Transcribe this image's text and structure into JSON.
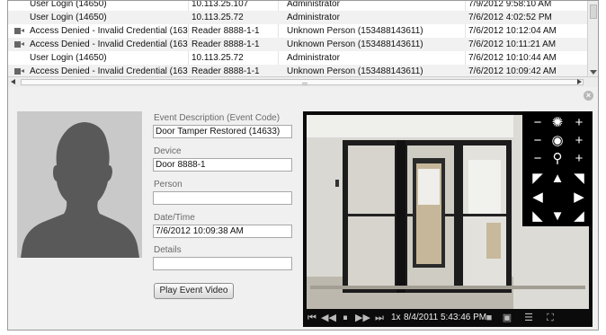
{
  "events": [
    {
      "icon": false,
      "description": "User Login (14650)",
      "device": "10.113.25.107",
      "person": "Administrator",
      "datetime": "7/9/2012 9:58:10 AM"
    },
    {
      "icon": false,
      "description": "User Login (14650)",
      "device": "10.113.25.72",
      "person": "Administrator",
      "datetime": "7/6/2012 4:02:52 PM"
    },
    {
      "icon": true,
      "description": "Access Denied - Invalid Credential (163...",
      "device": "Reader 8888-1-1",
      "person": "Unknown Person (153488143611)",
      "datetime": "7/6/2012 10:12:04 AM"
    },
    {
      "icon": true,
      "description": "Access Denied - Invalid Credential (163...",
      "device": "Reader 8888-1-1",
      "person": "Unknown Person (153488143611)",
      "datetime": "7/6/2012 10:11:21 AM"
    },
    {
      "icon": false,
      "description": "User Login (14650)",
      "device": "10.113.25.72",
      "person": "Administrator",
      "datetime": "7/6/2012 10:10:44 AM"
    },
    {
      "icon": true,
      "description": "Access Denied - Invalid Credential (163...",
      "device": "Reader 8888-1-1",
      "person": "Unknown Person (153488143611)",
      "datetime": "7/6/2012 10:09:42 AM"
    }
  ],
  "detail": {
    "close_glyph": "×",
    "event_description_label": "Event Description (Event Code)",
    "event_description_value": "Door Tamper Restored (14633)",
    "device_label": "Device",
    "device_value": "Door 8888-1",
    "person_label": "Person",
    "person_value": "",
    "datetime_label": "Date/Time",
    "datetime_value": "7/6/2012 10:09:38 AM",
    "details_label": "Details",
    "details_value": "",
    "play_button": "Play Event Video"
  },
  "video": {
    "speed": "1x",
    "timestamp": "8/4/2011 5:43:46 PM",
    "ptz_icons": [
      "zoom-out-icon",
      "iris-icon",
      "zoom-in-icon",
      "focus-near-icon",
      "focus-icon",
      "focus-far-icon",
      "zoom-minus-icon",
      "magnifier-icon",
      "zoom-plus-icon",
      "pan-up-left-icon",
      "pan-up-icon",
      "pan-up-right-icon",
      "pan-left-icon",
      "pan-right-icon",
      "pan-down-left-icon",
      "pan-down-icon",
      "pan-down-right-icon"
    ],
    "playback_icons": [
      "skip-to-start-icon",
      "rewind-icon",
      "pause-icon",
      "fast-forward-icon",
      "skip-to-end-icon",
      "snapshot-icon",
      "export-icon",
      "menu-icon",
      "fullscreen-icon"
    ]
  },
  "colors": {
    "panel_bg": "#f0f0f0",
    "video_bg": "#0b0b0b",
    "row_alt": "#f1f1f1"
  }
}
